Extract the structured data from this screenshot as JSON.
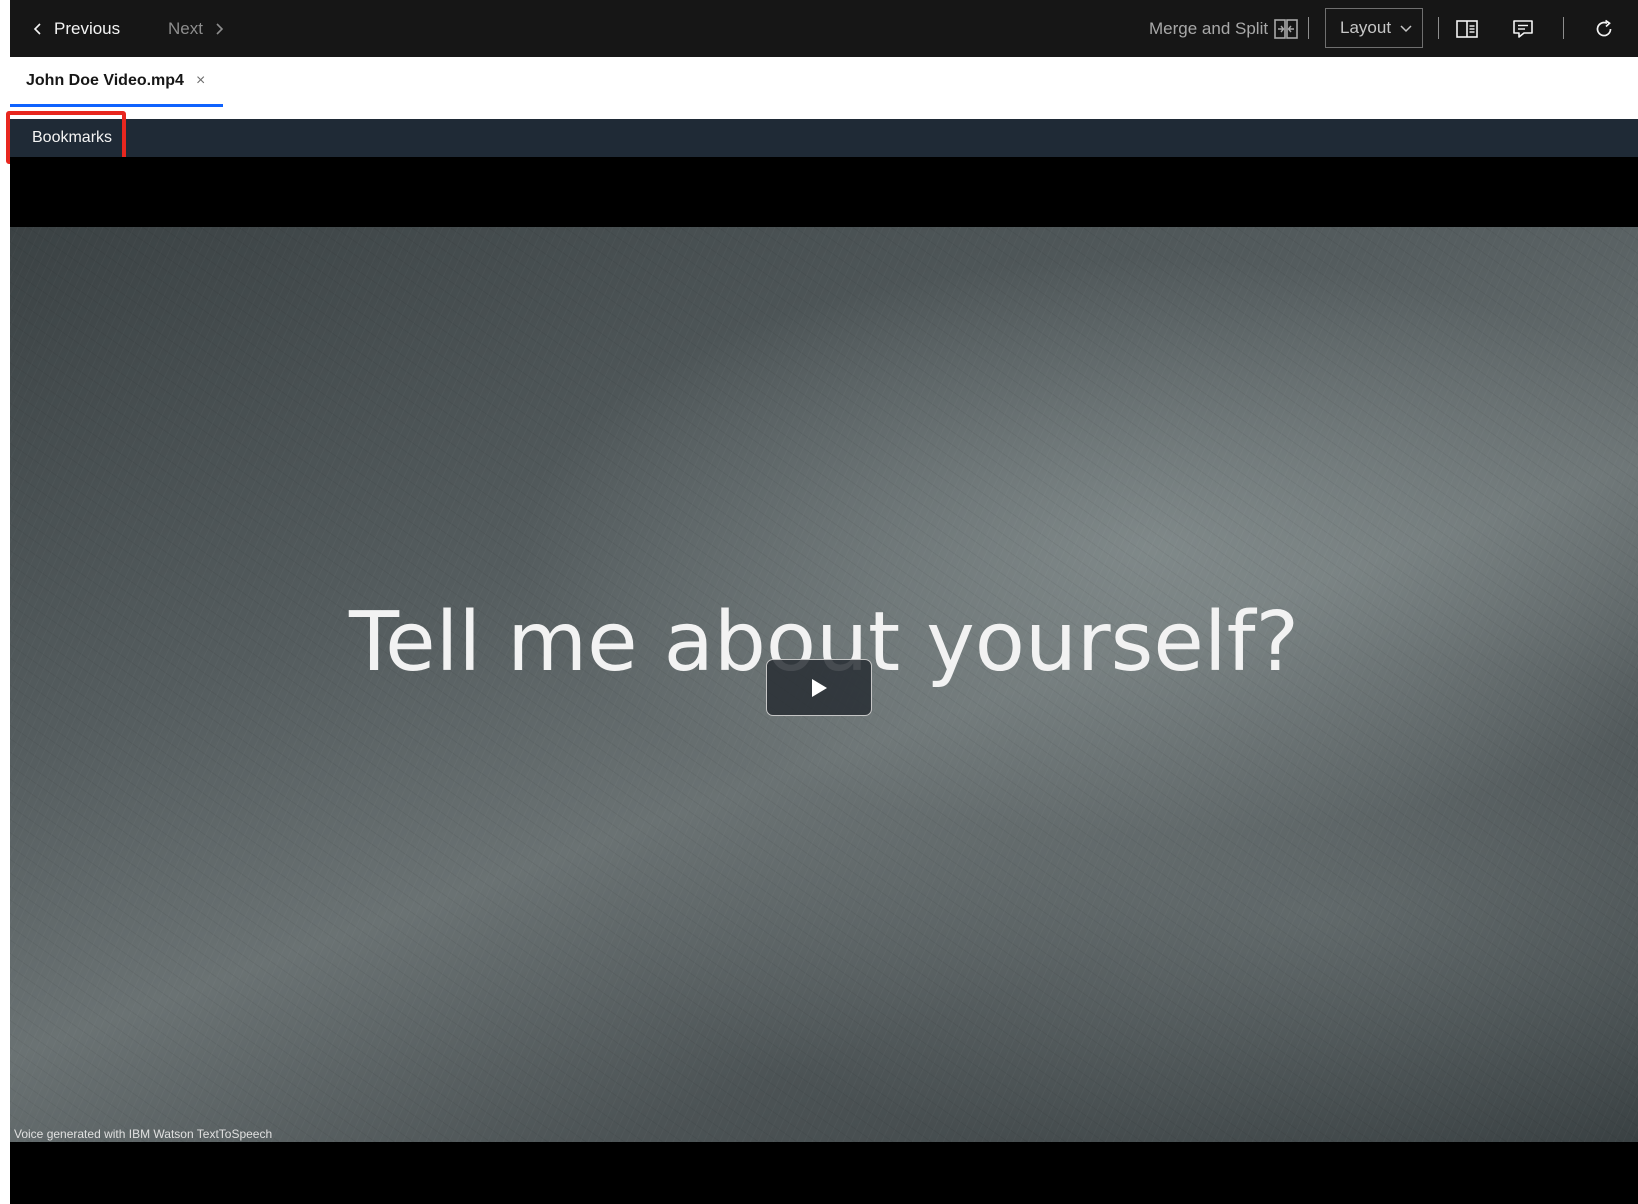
{
  "toolbar": {
    "previous_label": "Previous",
    "next_label": "Next",
    "merge_split_label": "Merge and Split",
    "layout_label": "Layout",
    "icons": [
      "chevron-left-icon",
      "chevron-right-icon",
      "merge-split-icon",
      "chevron-down-icon",
      "side-panel-icon",
      "comment-icon",
      "refresh-icon"
    ]
  },
  "tab": {
    "label": "John Doe Video.mp4",
    "close_glyph": "×"
  },
  "bookmarks": {
    "label": "Bookmarks"
  },
  "video": {
    "slide_title": "Tell me about yourself?",
    "credit": "Voice  generated with  IBM Watson TextToSpeech"
  },
  "colors": {
    "toolbar_bg": "#161616",
    "tab_underline": "#0f62fe",
    "bookmarks_bar_bg": "#1f2a36",
    "highlight": "#e8271f"
  }
}
